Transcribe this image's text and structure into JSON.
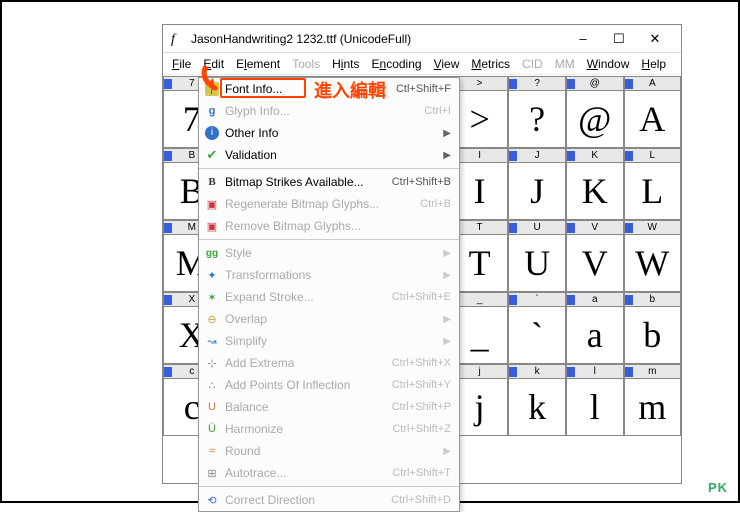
{
  "window": {
    "title": "JasonHandwriting2  1232.ttf (UnicodeFull)",
    "controls": {
      "min": "–",
      "max": "☐",
      "close": "✕"
    }
  },
  "menubar": {
    "file": "File",
    "edit": "Edit",
    "element": "Element",
    "tools": "Tools",
    "hints": "Hints",
    "encoding": "Encoding",
    "view": "View",
    "metrics": "Metrics",
    "cid": "CID",
    "mm": "MM",
    "window": "Window",
    "help": "Help"
  },
  "annotation": "進入編輯",
  "watermark": "PK",
  "dropdown": {
    "items": [
      {
        "label": "Font Info...",
        "shortcut": "Ctl+Shift+F",
        "icon": "f",
        "disabled": false,
        "sub": false
      },
      {
        "label": "Glyph Info...",
        "shortcut": "Ctrl+I",
        "icon": "g",
        "disabled": true,
        "sub": false
      },
      {
        "label": "Other Info",
        "shortcut": "",
        "icon": "info",
        "disabled": false,
        "sub": true
      },
      {
        "label": "Validation",
        "shortcut": "",
        "icon": "check",
        "disabled": false,
        "sub": true
      },
      {
        "sep": true
      },
      {
        "label": "Bitmap Strikes Available...",
        "shortcut": "Ctrl+Shift+B",
        "icon": "b",
        "disabled": false,
        "sub": false
      },
      {
        "label": "Regenerate Bitmap Glyphs...",
        "shortcut": "Ctrl+B",
        "icon": "bm",
        "disabled": true,
        "sub": false
      },
      {
        "label": "Remove Bitmap Glyphs...",
        "shortcut": "",
        "icon": "bm",
        "disabled": true,
        "sub": false
      },
      {
        "sep": true
      },
      {
        "label": "Style",
        "shortcut": "",
        "icon": "gg",
        "disabled": true,
        "sub": true
      },
      {
        "label": "Transformations",
        "shortcut": "",
        "icon": "trans",
        "disabled": true,
        "sub": true
      },
      {
        "label": "Expand Stroke...",
        "shortcut": "Ctrl+Shift+E",
        "icon": "exp",
        "disabled": true,
        "sub": false
      },
      {
        "label": "Overlap",
        "shortcut": "",
        "icon": "over",
        "disabled": true,
        "sub": true
      },
      {
        "label": "Simplify",
        "shortcut": "",
        "icon": "simp",
        "disabled": true,
        "sub": true
      },
      {
        "label": "Add Extrema",
        "shortcut": "Ctrl+Shift+X",
        "icon": "ext",
        "disabled": true,
        "sub": false
      },
      {
        "label": "Add Points Of Inflection",
        "shortcut": "Ctrl+Shift+Y",
        "icon": "pts",
        "disabled": true,
        "sub": false
      },
      {
        "label": "Balance",
        "shortcut": "Ctrl+Shift+P",
        "icon": "bal",
        "disabled": true,
        "sub": false
      },
      {
        "label": "Harmonize",
        "shortcut": "Ctrl+Shift+Z",
        "icon": "harm",
        "disabled": true,
        "sub": false
      },
      {
        "label": "Round",
        "shortcut": "",
        "icon": "round",
        "disabled": true,
        "sub": true
      },
      {
        "label": "Autotrace...",
        "shortcut": "Ctrl+Shift+T",
        "icon": "auto",
        "disabled": true,
        "sub": false
      },
      {
        "sep": true
      },
      {
        "label": "Correct Direction",
        "shortcut": "Ctrl+Shift+D",
        "icon": "corr",
        "disabled": true,
        "sub": false
      }
    ]
  },
  "glyph_grid": {
    "row1": {
      "hdr": [
        "7",
        "",
        "",
        "",
        "",
        ">",
        "?",
        "@",
        "A"
      ],
      "val": [
        "7",
        "",
        "",
        "",
        "",
        ">",
        "?",
        "@",
        "A"
      ]
    },
    "row2": {
      "hdr": [
        "B",
        "",
        "",
        "",
        "",
        "I",
        "J",
        "K",
        "L"
      ],
      "val": [
        "B",
        "",
        "",
        "",
        "",
        "I",
        "J",
        "K",
        "L"
      ]
    },
    "row3": {
      "hdr": [
        "M",
        "",
        "",
        "",
        "",
        "T",
        "U",
        "V",
        "W"
      ],
      "val": [
        "M",
        "",
        "",
        "",
        "",
        "T",
        "U",
        "V",
        "W"
      ]
    },
    "row4": {
      "hdr": [
        "X",
        "",
        "",
        "",
        "",
        "_",
        "`",
        "a",
        "b"
      ],
      "val": [
        "X",
        "",
        "",
        "",
        "",
        "_",
        "`",
        "a",
        "b"
      ]
    },
    "row5": {
      "hdr": [
        "c",
        "",
        "",
        "",
        "",
        "j",
        "k",
        "l",
        "m"
      ],
      "val": [
        "c",
        "",
        "",
        "",
        "",
        "j",
        "k",
        "l",
        "m"
      ]
    }
  }
}
